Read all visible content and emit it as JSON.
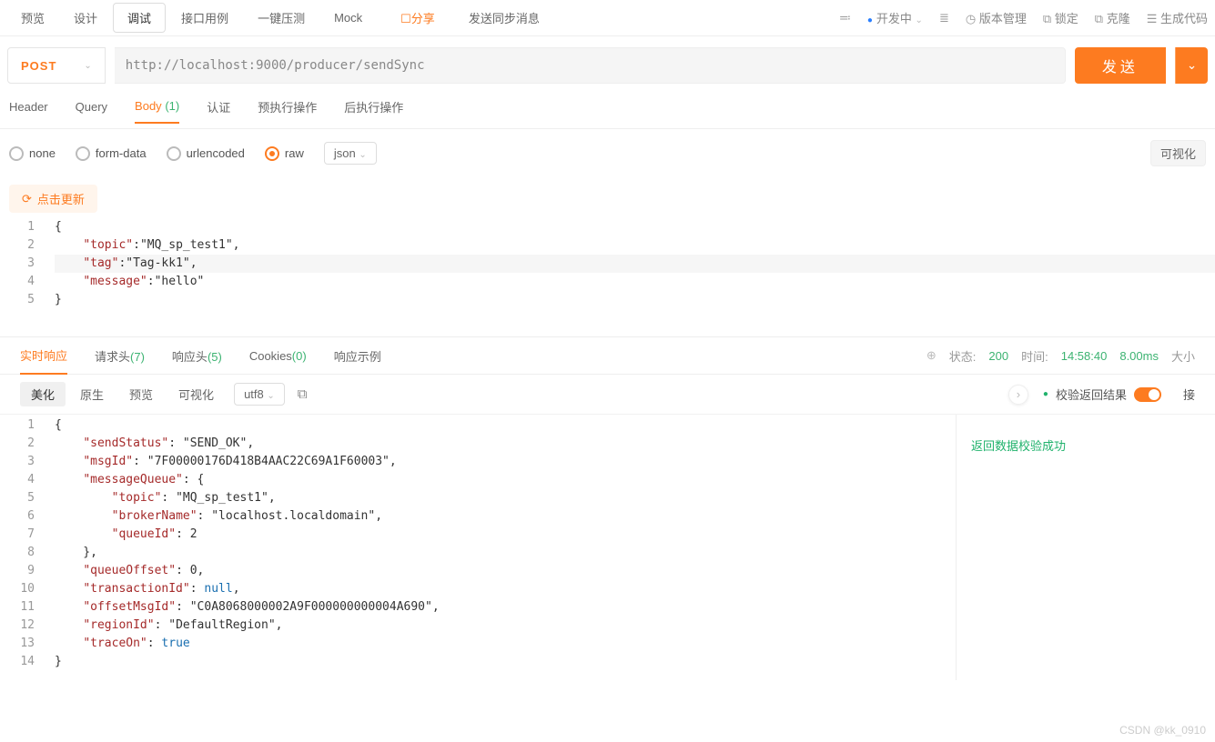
{
  "topnav": {
    "tabs": [
      "预览",
      "设计",
      "调试",
      "接口用例",
      "一键压测",
      "Mock"
    ],
    "active_index": 2,
    "share": "分享",
    "title": "发送同步消息",
    "dev_status": "开发中",
    "right_items": {
      "version": "版本管理",
      "lock": "锁定",
      "clone": "克隆",
      "gencode": "生成代码"
    }
  },
  "request": {
    "method": "POST",
    "url": "http://localhost:9000/producer/sendSync",
    "send": "发送"
  },
  "reqtabs": {
    "header": "Header",
    "query": "Query",
    "body": "Body",
    "body_count": "(1)",
    "auth": "认证",
    "pre": "预执行操作",
    "post": "后执行操作"
  },
  "bodytype": {
    "none": "none",
    "form": "form-data",
    "url": "urlencoded",
    "raw": "raw",
    "raw_fmt": "json",
    "visualize": "可视化"
  },
  "refresh": "点击更新",
  "req_body_lines": [
    "{",
    "    \"topic\":\"MQ_sp_test1\",",
    "    \"tag\":\"Tag-kk1\",",
    "    \"message\":\"hello\"",
    "}"
  ],
  "resptabs": {
    "realtime": "实时响应",
    "reqhead": "请求头",
    "reqhead_cnt": "(7)",
    "resphead": "响应头",
    "resphead_cnt": "(5)",
    "cookies": "Cookies",
    "cookies_cnt": "(0)",
    "example": "响应示例"
  },
  "respmeta": {
    "status_label": "状态:",
    "status_code": "200",
    "time_label": "时间:",
    "time_val": "14:58:40",
    "duration": "8.00ms",
    "size": "大小"
  },
  "resptool": {
    "beautify": "美化",
    "raw": "原生",
    "preview": "预览",
    "visual": "可视化",
    "enc": "utf8",
    "validate_label": "校验返回结果",
    "extra": "接"
  },
  "validation_msg": "返回数据校验成功",
  "resp_body_lines": [
    "{",
    "    \"sendStatus\": \"SEND_OK\",",
    "    \"msgId\": \"7F00000176D418B4AAC22C69A1F60003\",",
    "    \"messageQueue\": {",
    "        \"topic\": \"MQ_sp_test1\",",
    "        \"brokerName\": \"localhost.localdomain\",",
    "        \"queueId\": 2",
    "    },",
    "    \"queueOffset\": 0,",
    "    \"transactionId\": null,",
    "    \"offsetMsgId\": \"C0A8068000002A9F000000000004A690\",",
    "    \"regionId\": \"DefaultRegion\",",
    "    \"traceOn\": true",
    "}"
  ],
  "watermark": "CSDN @kk_0910"
}
